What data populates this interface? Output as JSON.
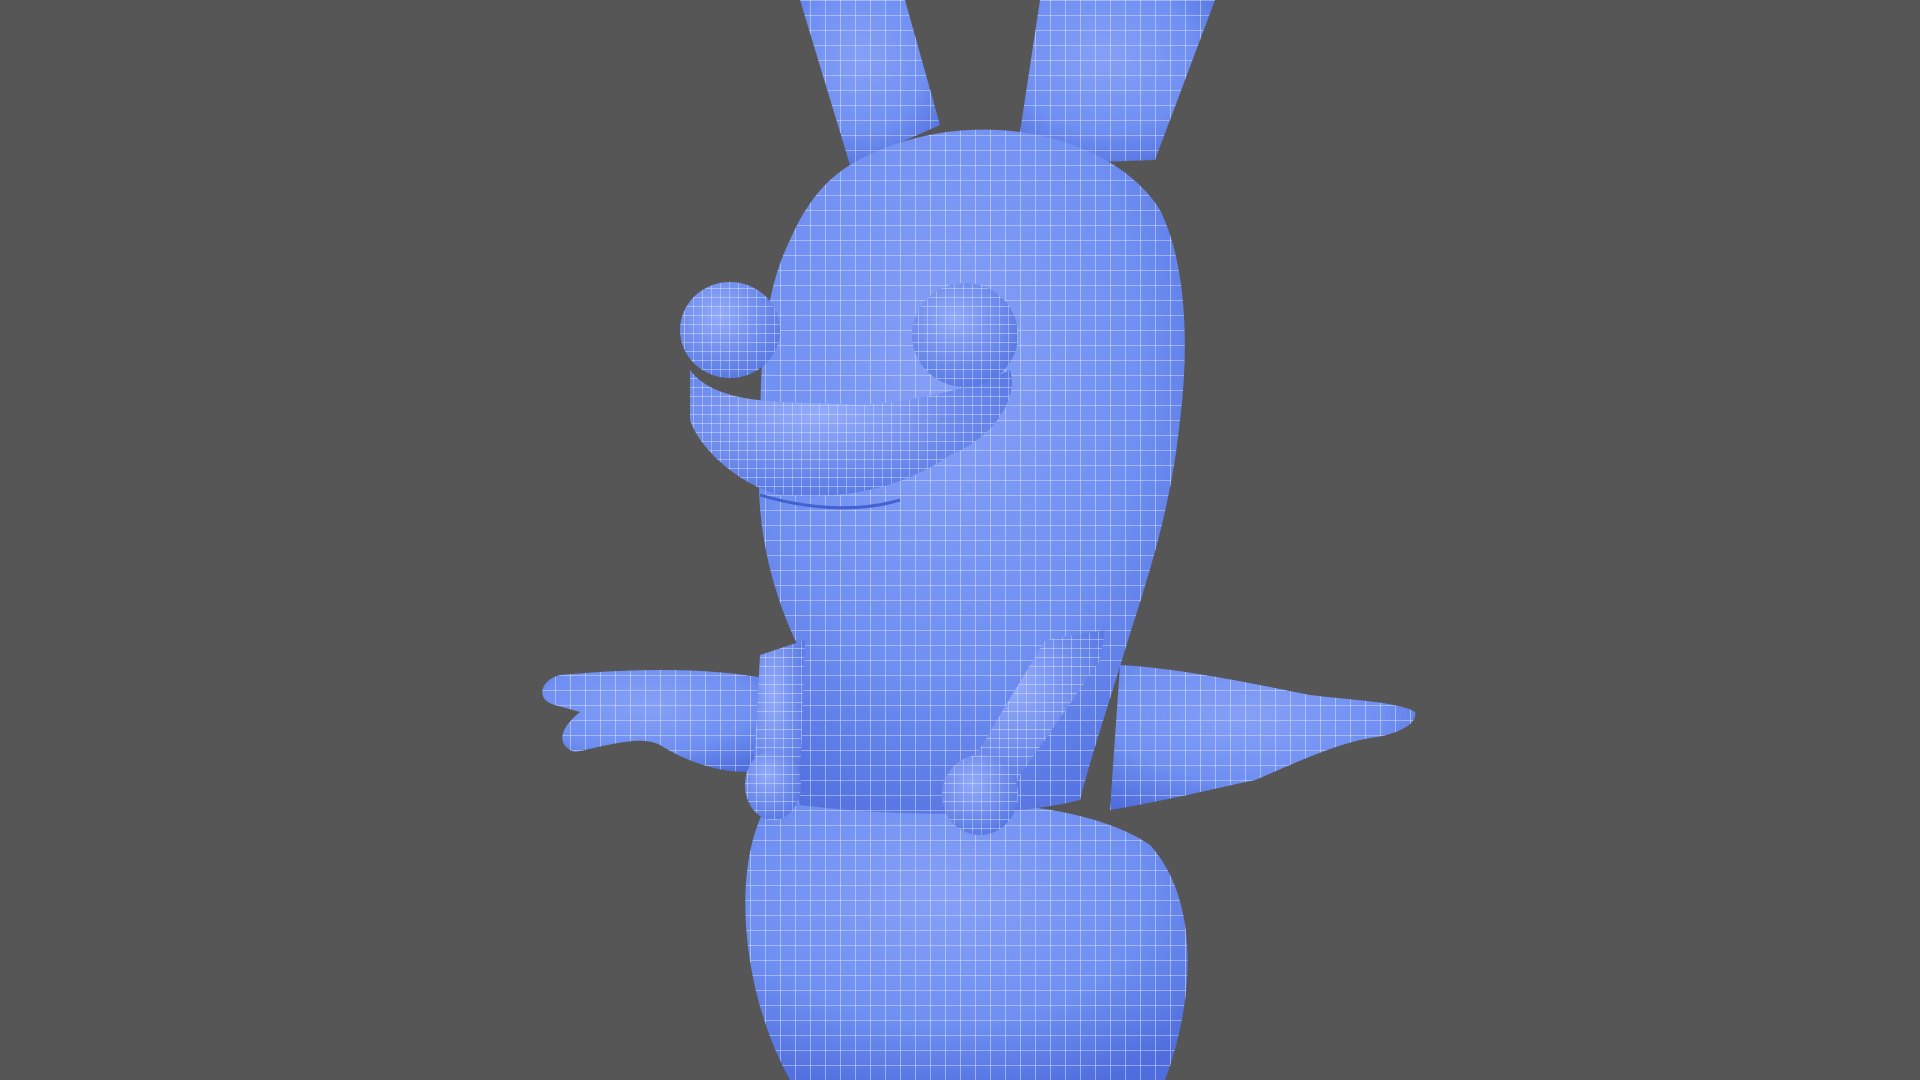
{
  "viewport": {
    "background_color": "#565656",
    "render_mode": "wireframe-on-shaded"
  },
  "model": {
    "subject": "rabbid-character",
    "pose": "t-pose",
    "mesh_color": "#6f8ff2",
    "mesh_shadow_color": "#4a68d8",
    "mesh_highlight_color": "#9fb4ff",
    "wire_color": "#e4ecff"
  }
}
